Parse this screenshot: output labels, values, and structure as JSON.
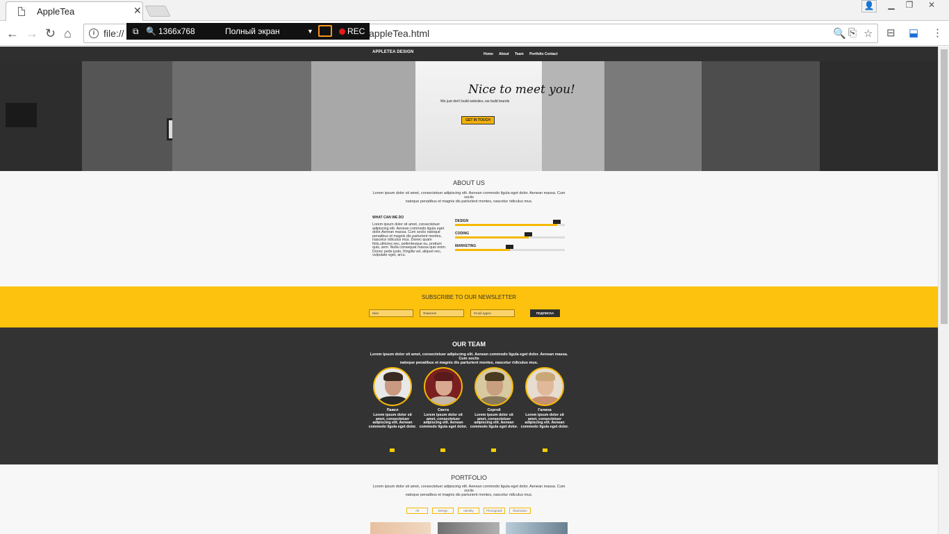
{
  "browser": {
    "tab_title": "AppleTea",
    "url_prefix": "file://",
    "url_suffix": "appleTea.html",
    "recorder": {
      "resolution": "1366x768",
      "mode": "Полный экран",
      "rec_label": "REC"
    }
  },
  "site": {
    "logo": "APPLETEA DESIGN",
    "nav": [
      "Home",
      "About",
      "Team",
      "Portfolio Contact"
    ],
    "hero": {
      "title": "Nice to meet you!",
      "subtitle": "We just don't build websites, we build brands",
      "button": "GET IN TOUCH"
    },
    "about": {
      "title": "ABOUT US",
      "text_line1": "Lorem ipsum dolor sit amet, consectetuer adipiscing elit. Aenean commodo ligula eget dolor. Aenean massa. Cum sociis",
      "text_line2": "natoque penatibus et magnis dis parturient montes, nascetur ridiculus mus.",
      "what_title": "WHAT CAN WE DO",
      "what_text": "Lorem ipsum dolor sit amet, consectetuer adipiscing elit. Aenean commodo ligula eget dolor.Aenean massa. Cum sociis natoque penatibus et magnis dis parturient montes, nascetur ridiculus mus. Donec quam felis,ultricies nec, pellentesque eu, pretium quis, sem. Nulla consequat massa quis enim. Donec pede justo, fringilla vel, aliquet nec, vulputate eget, arcu.",
      "skills": [
        {
          "label": "DESIGN",
          "level": 0.93
        },
        {
          "label": "CODING",
          "level": 0.67
        },
        {
          "label": "MARKETING",
          "level": 0.5
        }
      ]
    },
    "newsletter": {
      "title": "SUBSCRIBE TO OUR NEWSLETTER",
      "name_placeholder": "Имя",
      "surname_placeholder": "Фамилия",
      "email_placeholder": "Email-адрес",
      "button": "ПОДПИСКА"
    },
    "team": {
      "title": "OUR TEAM",
      "text_line1": "Lorem ipsum dolor sit amet, consectetuer adipiscing elit. Aenean commodo ligula eget dolor. Aenean massa. Cum sociis",
      "text_line2": "natoque penatibus et magnis dis parturient montes, nascetur ridiculus mus.",
      "members": [
        {
          "name": "Павел",
          "bio": "Lorem ipsum dolor sit amet, consectetuer adipiscing elit. Aenean commodo ligula eget dolor."
        },
        {
          "name": "Света",
          "bio": "Lorem ipsum dolor sit amet, consectetuer adipiscing elit. Aenean commodo ligula eget dolor."
        },
        {
          "name": "Сергей",
          "bio": "Lorem ipsum dolor sit amet, consectetuer adipiscing elit. Aenean commodo ligula eget dolor."
        },
        {
          "name": "Галина",
          "bio": "Lorem ipsum dolor sit amet, consectetuer adipiscing elit. Aenean commodo ligula eget dolor."
        }
      ]
    },
    "portfolio": {
      "title": "PORTFOLIO",
      "text_line1": "Lorem ipsum dolor sit amet, consectetuer adipiscing elit. Aenean commodo ligula eget dolor. Aenean massa. Cum sociis",
      "text_line2": "natoque penatibus et magnis dis parturient montes, nascetur ridiculus mus.",
      "filters": [
        "All",
        "Design",
        "Identity",
        "Photograph",
        "Illustration"
      ]
    }
  },
  "colors": {
    "accent_yellow": "#fdc20d",
    "dark": "#333333",
    "light_bg": "#f7f7f7"
  }
}
